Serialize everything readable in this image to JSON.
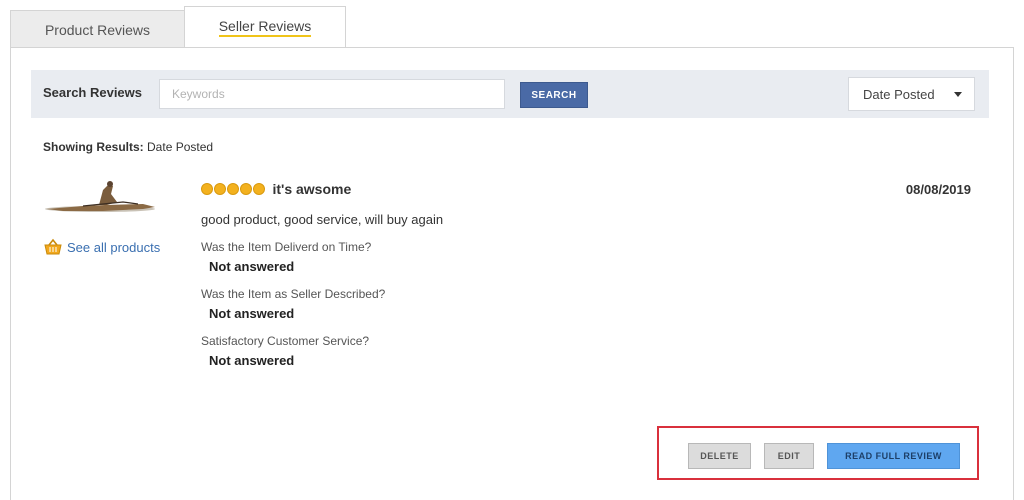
{
  "tabs": [
    {
      "label": "Product Reviews",
      "active": false
    },
    {
      "label": "Seller Reviews",
      "active": true
    }
  ],
  "search": {
    "label": "Search Reviews",
    "placeholder": "Keywords",
    "value": "",
    "button_label": "SEARCH"
  },
  "sort": {
    "selected": "Date Posted"
  },
  "results": {
    "prefix": "Showing Results:",
    "value": "Date Posted"
  },
  "review": {
    "rating": 5,
    "title": "it's awsome",
    "date": "08/08/2019",
    "body": "good product, good service, will buy again",
    "see_all_label": "See all products",
    "questions": [
      {
        "question": "Was the Item Deliverd on Time?",
        "answer": "Not answered"
      },
      {
        "question": "Was the Item as Seller Described?",
        "answer": "Not answered"
      },
      {
        "question": "Satisfactory Customer Service?",
        "answer": "Not answered"
      }
    ]
  },
  "actions": {
    "delete_label": "DELETE",
    "edit_label": "EDIT",
    "read_label": "READ FULL REVIEW"
  },
  "colors": {
    "accent_blue": "#4a6aa6",
    "read_button": "#5fa7f0",
    "highlight_red": "#d9303c",
    "star": "#f3b11e"
  }
}
